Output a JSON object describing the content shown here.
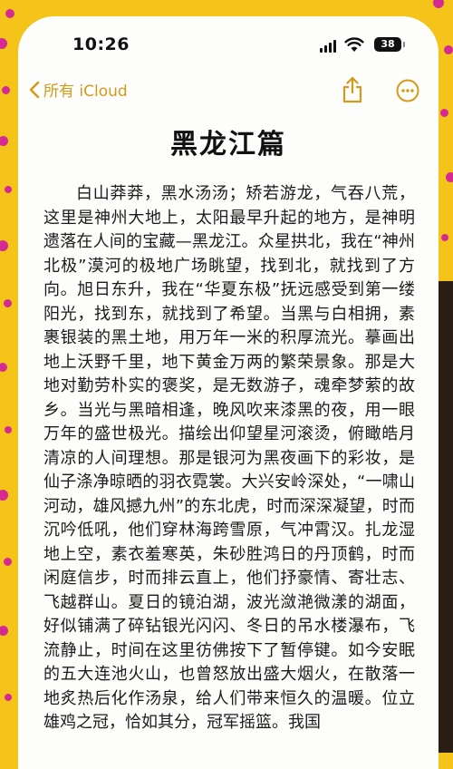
{
  "status": {
    "time": "10:26",
    "battery": "38"
  },
  "nav": {
    "back_label": "所有 iCloud"
  },
  "note": {
    "title": "黑龙江篇",
    "body": "白山莽莽，黑水汤汤；矫若游龙，气吞八荒，这里是神州大地上，太阳最早升起的地方，是神明遗落在人间的宝藏—黑龙江。众星拱北，我在“神州北极”漠河的极地广场眺望，找到北，就找到了方向。旭日东升，我在“华夏东极”抚远感受到第一缕阳光，找到东，就找到了希望。当黑与白相拥，素裹银装的黑土地，用万年一米的积厚流光。摹画出地上沃野千里，地下黄金万两的繁荣景象。那是大地对勤劳朴实的褒奖，是无数游子，魂牵梦萦的故乡。当光与黑暗相逢，晚风吹来漆黑的夜，用一眼万年的盛世极光。描绘出仰望星河滚烫，俯瞰皓月清凉的人间理想。那是银河为黑夜画下的彩妆，是仙子涤净晾晒的羽衣霓裳。大兴安岭深处，“一啸山河动，雄风撼九州”的东北虎，时而深深凝望，时而沉吟低吼，他们穿林海跨雪原，气冲霄汉。扎龙湿地上空，素衣羞寒英，朱砂胜鸿日的丹顶鹤，时而闲庭信步，时而排云直上，他们抒豪情、寄壮志、飞越群山。夏日的镜泊湖，波光潋滟微漾的湖面，好似铺满了碎钻银光闪闪、冬日的吊水楼瀑布，飞流静止，时间在这里彷佛按下了暂停键。如今安眠的五大连池火山，也曾怒放出盛大烟火，在散落一地炙热后化作汤泉，给人们带来恒久的温暖。位立雄鸡之冠，恰如其分，冠军摇篮。我国"
  }
}
